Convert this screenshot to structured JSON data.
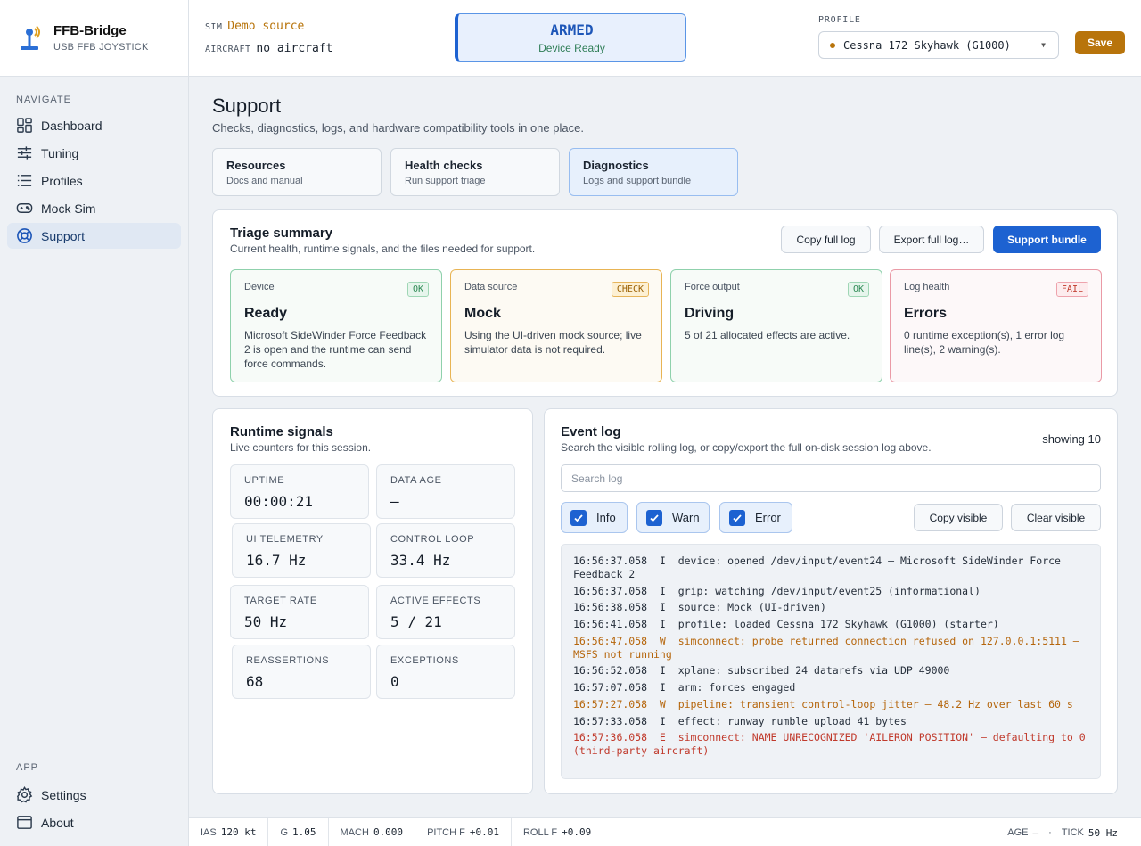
{
  "brand": {
    "title": "FFB-Bridge",
    "subtitle": "USB FFB JOYSTICK"
  },
  "nav": {
    "section": "NAVIGATE",
    "items": [
      {
        "label": "Dashboard",
        "icon": "dashboard-icon"
      },
      {
        "label": "Tuning",
        "icon": "sliders-icon"
      },
      {
        "label": "Profiles",
        "icon": "list-icon"
      },
      {
        "label": "Mock Sim",
        "icon": "gamepad-icon"
      },
      {
        "label": "Support",
        "icon": "lifebuoy-icon",
        "active": true
      }
    ],
    "app_section": "APP",
    "app_items": [
      {
        "label": "Settings",
        "icon": "gear-icon"
      },
      {
        "label": "About",
        "icon": "window-icon"
      }
    ]
  },
  "topbar": {
    "sim_tag": "SIM",
    "sim_value": "Demo source",
    "aircraft_tag": "AIRCRAFT",
    "aircraft_value": "no aircraft",
    "armed_title": "ARMED",
    "armed_sub": "Device Ready",
    "profile_label": "PROFILE",
    "profile_value": "Cessna 172 Skyhawk (G1000)",
    "save_label": "Save"
  },
  "page": {
    "title": "Support",
    "subtitle": "Checks, diagnostics, logs, and hardware compatibility tools in one place.",
    "tabs": [
      {
        "title": "Resources",
        "sub": "Docs and manual"
      },
      {
        "title": "Health checks",
        "sub": "Run support triage"
      },
      {
        "title": "Diagnostics",
        "sub": "Logs and support bundle",
        "active": true
      }
    ]
  },
  "triage": {
    "title": "Triage summary",
    "subtitle": "Current health, runtime signals, and the files needed for support.",
    "copy_label": "Copy full log",
    "export_label": "Export full log…",
    "bundle_label": "Support bundle",
    "cards": [
      {
        "label": "Device",
        "badge": "OK",
        "value": "Ready",
        "desc": "Microsoft SideWinder Force Feedback 2 is open and the runtime can send force commands."
      },
      {
        "label": "Data source",
        "badge": "CHECK",
        "value": "Mock",
        "desc": "Using the UI-driven mock source; live simulator data is not required."
      },
      {
        "label": "Force output",
        "badge": "OK",
        "value": "Driving",
        "desc": "5 of 21 allocated effects are active."
      },
      {
        "label": "Log health",
        "badge": "FAIL",
        "value": "Errors",
        "desc": "0 runtime exception(s), 1 error log line(s), 2 warning(s)."
      }
    ]
  },
  "runtime": {
    "title": "Runtime signals",
    "subtitle": "Live counters for this session.",
    "metrics": [
      {
        "label": "UPTIME",
        "value": "00:00:21"
      },
      {
        "label": "DATA AGE",
        "value": "—"
      },
      {
        "label": "UI TELEMETRY",
        "value": "16.7 Hz"
      },
      {
        "label": "CONTROL LOOP",
        "value": "33.4 Hz"
      },
      {
        "label": "TARGET RATE",
        "value": "50 Hz"
      },
      {
        "label": "ACTIVE EFFECTS",
        "value": "5 / 21"
      },
      {
        "label": "REASSERTIONS",
        "value": "68"
      },
      {
        "label": "EXCEPTIONS",
        "value": "0"
      }
    ]
  },
  "eventlog": {
    "title": "Event log",
    "subtitle": "Search the visible rolling log, or copy/export the full on-disk session log above.",
    "showing": "showing 10",
    "search_placeholder": "Search log",
    "filters": [
      {
        "label": "Info",
        "checked": true
      },
      {
        "label": "Warn",
        "checked": true
      },
      {
        "label": "Error",
        "checked": true
      }
    ],
    "copy_visible_label": "Copy visible",
    "clear_visible_label": "Clear visible",
    "lines": [
      {
        "level": "I",
        "text": "16:56:37.058  I  device: opened /dev/input/event24 — Microsoft SideWinder Force Feedback 2"
      },
      {
        "level": "I",
        "text": "16:56:37.058  I  grip: watching /dev/input/event25 (informational)"
      },
      {
        "level": "I",
        "text": "16:56:38.058  I  source: Mock (UI-driven)"
      },
      {
        "level": "I",
        "text": "16:56:41.058  I  profile: loaded Cessna 172 Skyhawk (G1000) (starter)"
      },
      {
        "level": "W",
        "text": "16:56:47.058  W  simconnect: probe returned connection refused on 127.0.0.1:5111 — MSFS not running"
      },
      {
        "level": "I",
        "text": "16:56:52.058  I  xplane: subscribed 24 datarefs via UDP 49000"
      },
      {
        "level": "I",
        "text": "16:57:07.058  I  arm: forces engaged"
      },
      {
        "level": "W",
        "text": "16:57:27.058  W  pipeline: transient control-loop jitter — 48.2 Hz over last 60 s"
      },
      {
        "level": "I",
        "text": "16:57:33.058  I  effect: runway rumble upload 41 bytes"
      },
      {
        "level": "E",
        "text": "16:57:36.058  E  simconnect: NAME_UNRECOGNIZED 'AILERON POSITION' — defaulting to 0 (third-party aircraft)"
      }
    ]
  },
  "footer": {
    "cells": [
      {
        "label": "IAS",
        "value": "120 kt"
      },
      {
        "label": "G",
        "value": "1.05"
      },
      {
        "label": "MACH",
        "value": "0.000"
      },
      {
        "label": "PITCH F",
        "value": "+0.01"
      },
      {
        "label": "ROLL F",
        "value": "+0.09"
      }
    ],
    "age_label": "AGE",
    "age_value": "—",
    "sep": "·",
    "tick_label": "TICK",
    "tick_value": "50 Hz"
  },
  "colors": {
    "accent": "#1d62d1",
    "warn": "#b8740b",
    "ok": "#2e8a55",
    "fail": "#c0392b"
  }
}
